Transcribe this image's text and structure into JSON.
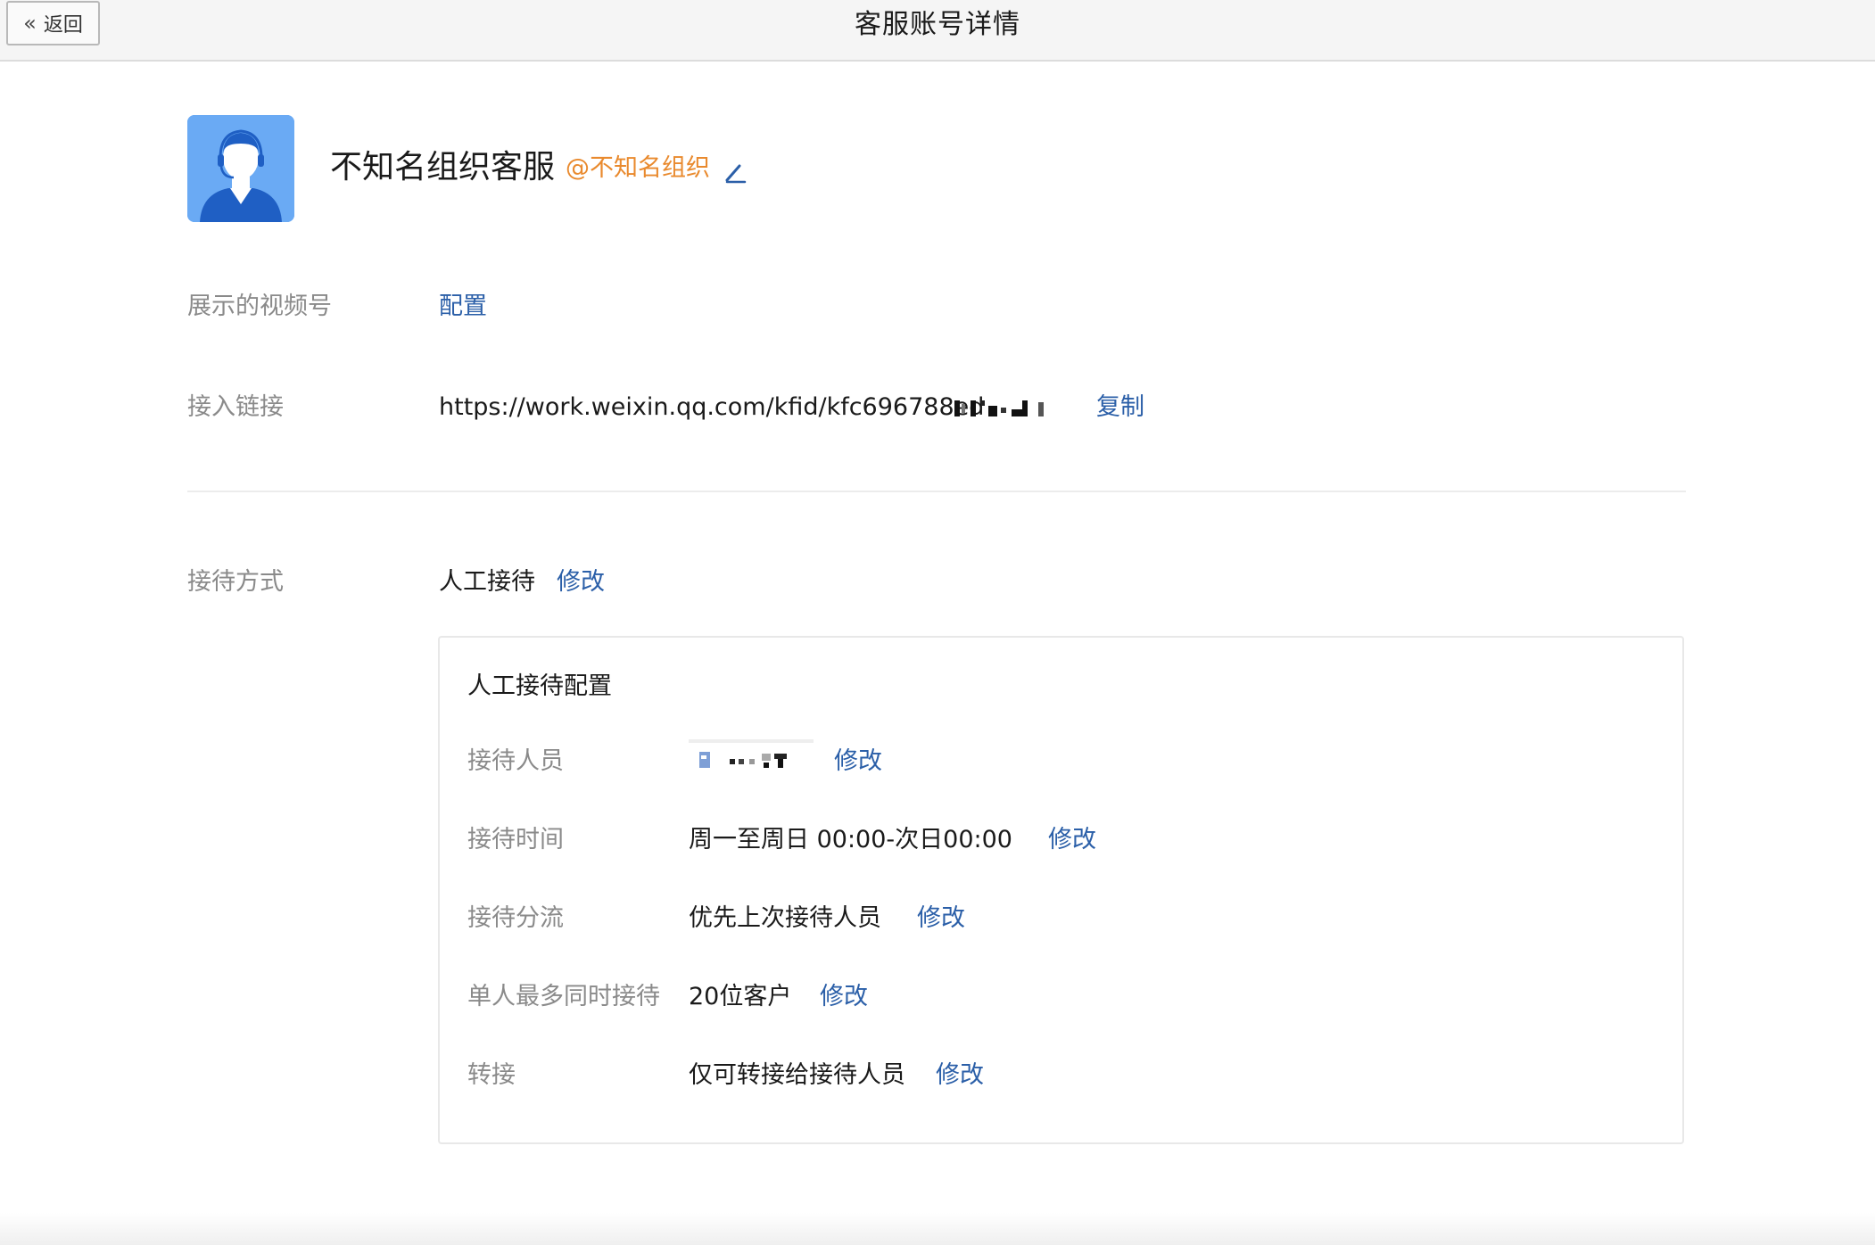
{
  "header": {
    "back_label": "返回",
    "title": "客服账号详情"
  },
  "account": {
    "name": "不知名组织客服",
    "org": "@不知名组织"
  },
  "fields": {
    "video_label": "展示的视频号",
    "video_action": "配置",
    "link_label": "接入链接",
    "link_value": "https://work.weixin.qq.com/kfid/kfc696788ed",
    "link_action": "复制",
    "mode_label": "接待方式",
    "mode_value": "人工接待",
    "mode_action": "修改"
  },
  "config": {
    "title": "人工接待配置",
    "rows": [
      {
        "label": "接待人员",
        "value": "",
        "action": "修改"
      },
      {
        "label": "接待时间",
        "value": "周一至周日 00:00-次日00:00",
        "action": "修改"
      },
      {
        "label": "接待分流",
        "value": "优先上次接待人员",
        "action": "修改"
      },
      {
        "label": "单人最多同时接待",
        "value": "20位客户",
        "action": "修改"
      },
      {
        "label": "转接",
        "value": "仅可转接给接待人员",
        "action": "修改"
      }
    ]
  },
  "icons": {
    "back": "double-chevron-left-icon",
    "edit": "pencil-icon",
    "avatar": "customer-service-agent-avatar"
  },
  "colors": {
    "link": "#2b5fa8",
    "org": "#e98a2e",
    "avatar_bg": "#6aaaf4"
  }
}
